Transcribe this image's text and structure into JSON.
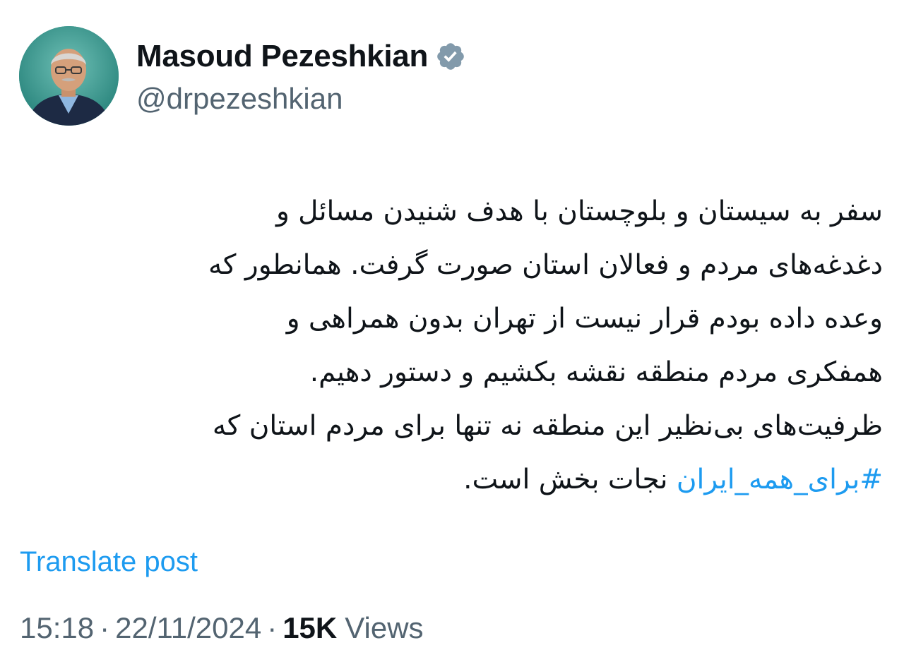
{
  "author": {
    "display_name": "Masoud Pezeshkian",
    "handle": "@drpezeshkian",
    "verified_icon": "verified-badge",
    "avatar_bg": "#2a8f86"
  },
  "tweet": {
    "lines": [
      "سفر به سیستان و بلوچستان با هدف شنیدن مسائل و",
      "دغدغه‌های مردم و فعالان استان صورت گرفت. همانطور که",
      "وعده داده بودم  قرار نیست از تهران بدون همراهی و",
      "همفکری مردم منطقه نقشه بکشیم و دستور دهیم.",
      "ظرفیت‌های بی‌نظیر این منطقه نه تنها برای مردم استان که"
    ],
    "hashtag": "#برای_همه_ایران",
    "last_line_rest": " نجات بخش است."
  },
  "translate_label": "Translate post",
  "meta": {
    "time": "15:18",
    "separator": "·",
    "date": "22/11/2024",
    "views_count": "15K",
    "views_label": "Views"
  },
  "colors": {
    "text": "#0f1419",
    "secondary": "#536471",
    "link": "#1d9bf0",
    "verified": "#829aab"
  }
}
